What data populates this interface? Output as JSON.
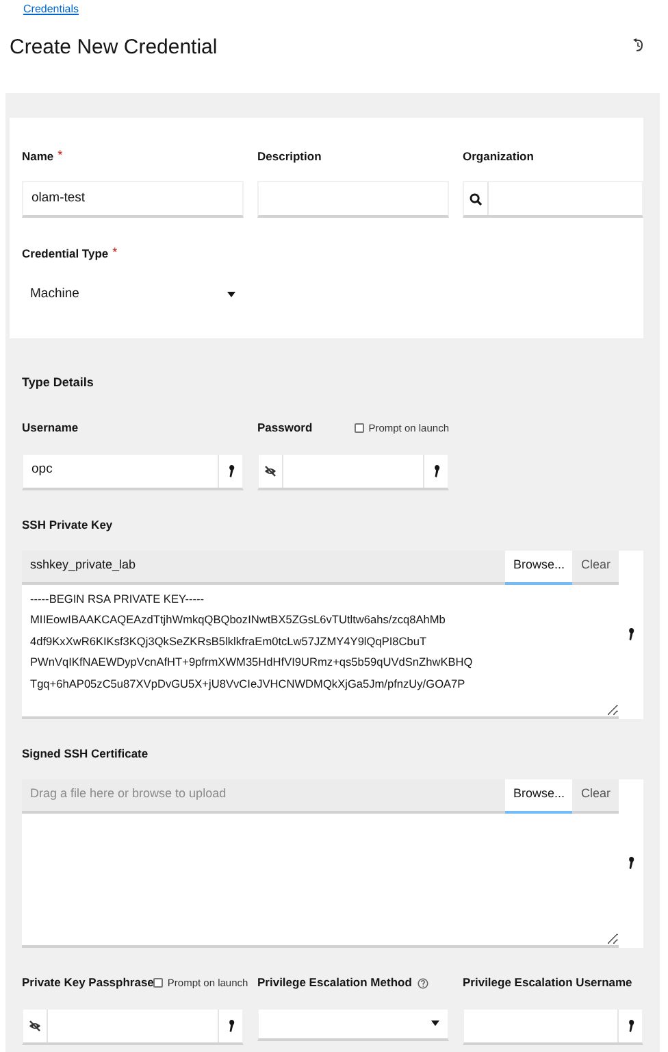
{
  "breadcrumb": "Credentials",
  "title": "Create New Credential",
  "main_fields": [
    {
      "label": "Name",
      "required_mark": "*",
      "kind": "text",
      "value": "olam-test"
    },
    {
      "label": "Description",
      "kind": "text"
    },
    {
      "label": "Organization",
      "kind": "lookup"
    }
  ],
  "credential_type": {
    "label": "Credential Type",
    "required_mark": "*",
    "kind": "select",
    "value": "Machine"
  },
  "type_details": {
    "heading": "Type Details",
    "rows": [
      [
        {
          "label": "Username",
          "kind": "text",
          "value": "opc",
          "key_button": true
        },
        {
          "label": "Password",
          "kind": "secret",
          "prompt": {
            "label": "Prompt on launch",
            "checked": false
          }
        }
      ],
      [
        {
          "label": "SSH Private Key",
          "kind": "file",
          "file_name": "sshkey_private_lab",
          "browse": "Browse...",
          "clear": "Clear",
          "content": [
            "-----BEGIN RSA PRIVATE KEY-----",
            "MIIEowIBAAKCAQEAzdTtjhWmkqQBQbozINwtBX5ZGsL6vTUtltw6ahs/zcq8AhMb",
            "4df9KxXwR6KIKsf3KQj3QkSeZKRsB5lklkfraEm0tcLw57JZMY4Y9lQqPI8CbuT",
            "PWnVqIKfNAEWDypVcnAfHT+9pfrmXWM35HdHfVI9URmz+qs5b59qUVdSnZhwKBHQ",
            "Tgq+6hAP05zC5u87XVpDvGU5X+jU8VvCIeJVHCNWDMQkXjGa5Jm/pfnzUy/GOA7P"
          ]
        }
      ],
      [
        {
          "label": "Signed SSH Certificate",
          "kind": "file",
          "placeholder": "Drag a file here or browse to upload",
          "browse": "Browse...",
          "clear": "Clear"
        }
      ],
      [
        {
          "label": "Private Key Passphrase",
          "kind": "secret",
          "prompt": {
            "label": "Prompt on launch",
            "checked": false
          }
        },
        {
          "label": "Privilege Escalation Method",
          "kind": "select",
          "help": true
        },
        {
          "label": "Privilege Escalation Username",
          "kind": "text",
          "key_button": true
        }
      ]
    ]
  }
}
